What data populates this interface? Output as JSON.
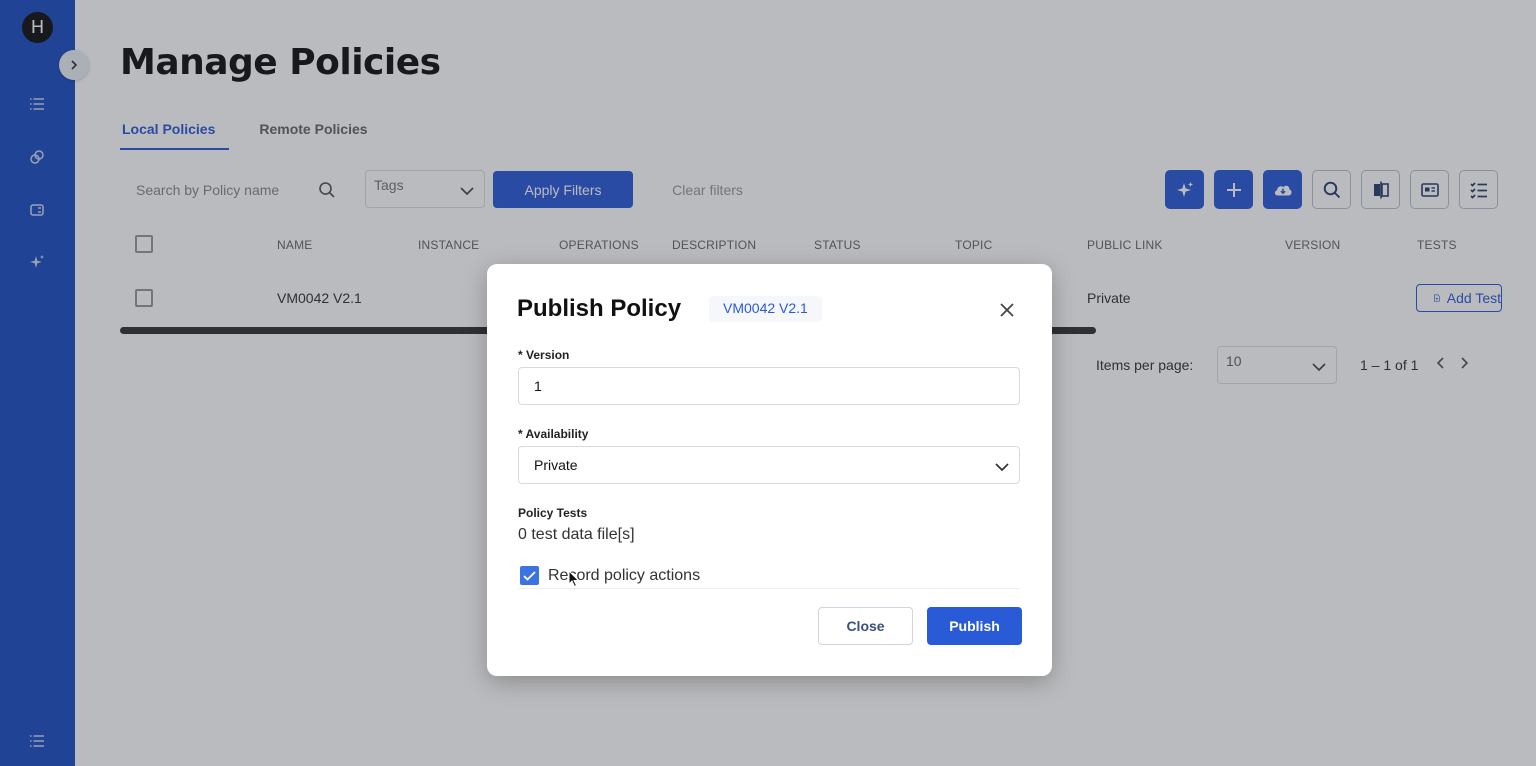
{
  "sidebar": {
    "logo_letter": "H",
    "items": [
      {
        "icon": "list-icon"
      },
      {
        "icon": "link-icon"
      },
      {
        "icon": "database-icon"
      },
      {
        "icon": "sparkle-icon"
      }
    ],
    "bottom_icon": "menu-icon"
  },
  "page": {
    "title": "Manage Policies",
    "tabs": [
      {
        "label": "Local Policies",
        "active": true
      },
      {
        "label": "Remote Policies",
        "active": false
      }
    ]
  },
  "filters": {
    "search_placeholder": "Search by Policy name",
    "tags_placeholder": "Tags",
    "apply_label": "Apply Filters",
    "clear_label": "Clear filters"
  },
  "toolbar": {
    "buttons": [
      "ai-sparkle-icon",
      "plus-icon",
      "cloud-download-icon",
      "search-icon",
      "compare-icon",
      "import-icon",
      "list-checks-icon"
    ]
  },
  "table": {
    "columns": [
      "NAME",
      "INSTANCE",
      "OPERATIONS",
      "DESCRIPTION",
      "STATUS",
      "TOPIC",
      "PUBLIC LINK",
      "VERSION",
      "TESTS"
    ],
    "rows": [
      {
        "name": "VM0042 V2.1",
        "public_link": "Private",
        "tests_button": "Add Test"
      }
    ]
  },
  "pagination": {
    "items_per_page_label": "Items per page:",
    "items_per_page": "10",
    "range": "1 – 1 of 1"
  },
  "modal": {
    "title": "Publish Policy",
    "policy_chip": "VM0042 V2.1",
    "version_label": "* Version",
    "version_value": "1",
    "availability_label": "* Availability",
    "availability_value": "Private",
    "tests_label": "Policy Tests",
    "tests_value": "0 test data file[s]",
    "record_label": "Record policy actions",
    "record_checked": true,
    "close_label": "Close",
    "publish_label": "Publish"
  },
  "colors": {
    "sidebar": "#1e4fc4",
    "accent": "#2a5bd7"
  }
}
